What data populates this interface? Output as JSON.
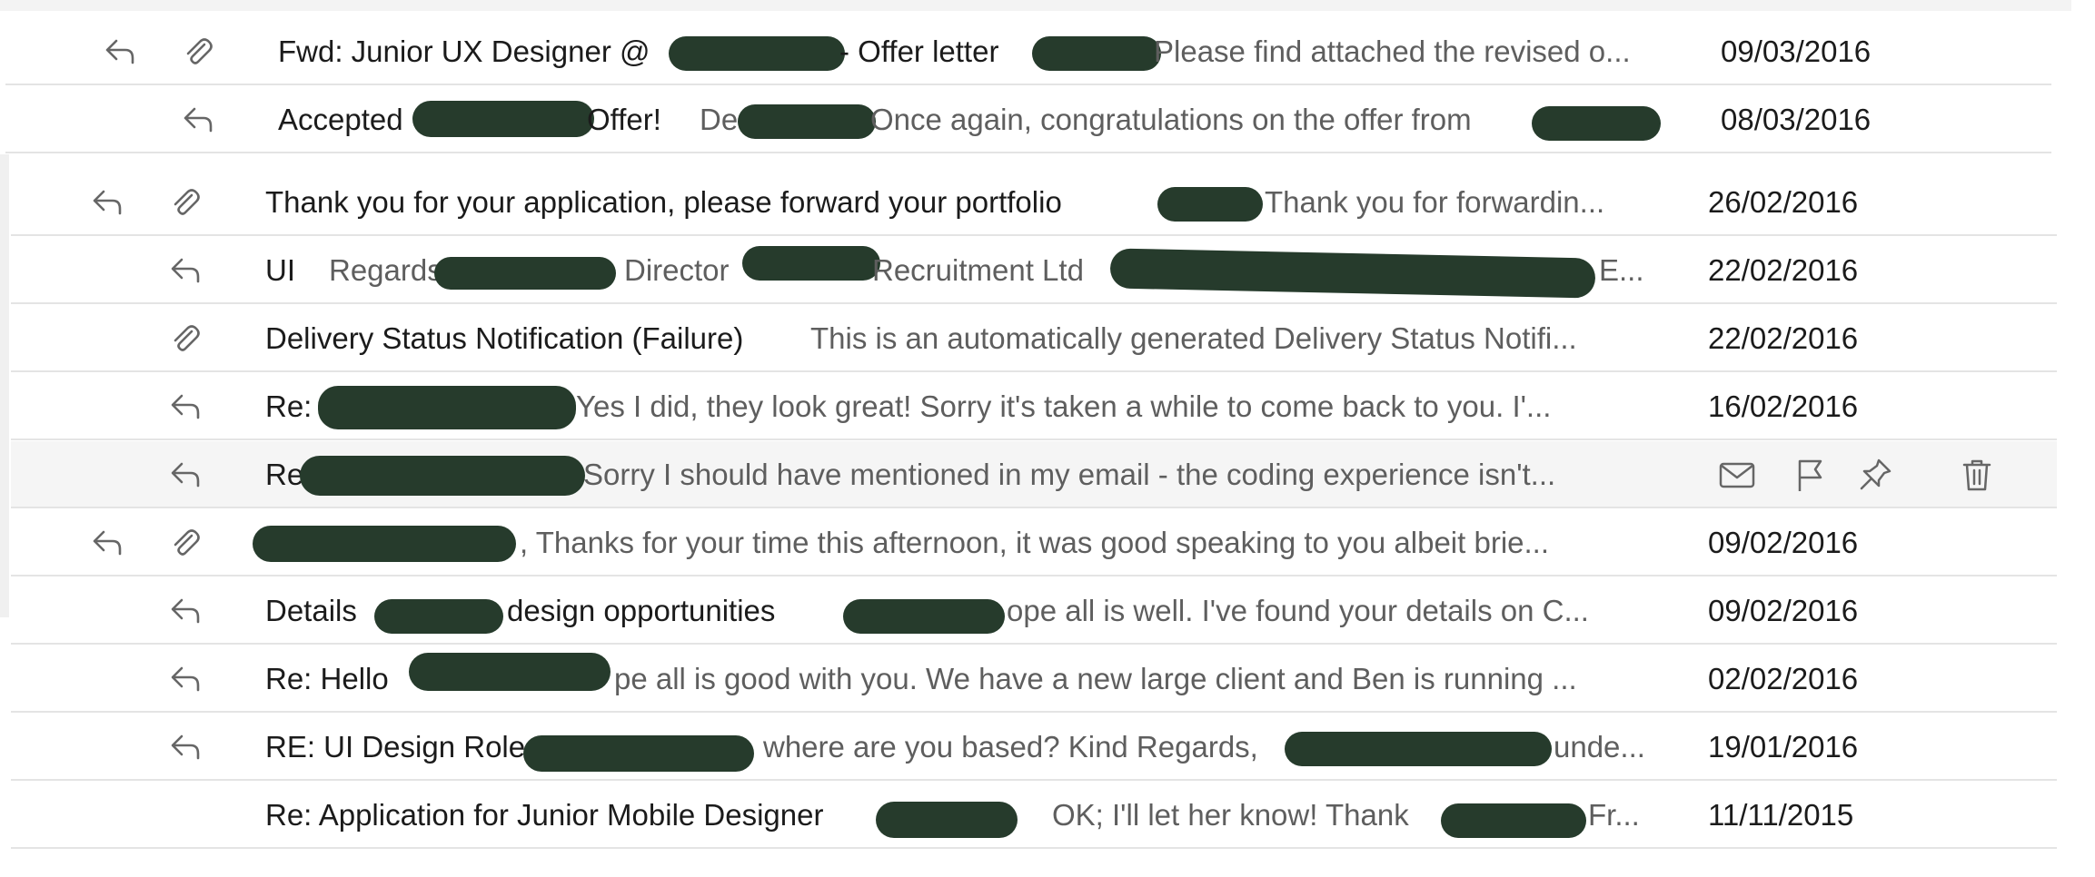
{
  "emails": [
    {
      "replied": true,
      "attachment": true,
      "subject": "Fwd: Junior UX Designer @",
      "subject2": "- Offer letter",
      "preview": "Please find attached the revised o...",
      "date": "09/03/2016"
    },
    {
      "replied": true,
      "attachment": false,
      "subject": "Accepted",
      "subject2": "Offer!",
      "preview": "De",
      "preview2": "Once again, congratulations on the offer from",
      "date": "08/03/2016"
    },
    {
      "replied": true,
      "attachment": true,
      "subject": "Thank you for your application, please forward your portfolio",
      "preview": "Thank you for forwardin...",
      "date": "26/02/2016"
    },
    {
      "replied": true,
      "attachment": false,
      "subject": "UI",
      "preview": "Regards",
      "preview2": "Director",
      "preview3": "Recruitment Ltd",
      "preview4": "E...",
      "date": "22/02/2016"
    },
    {
      "replied": false,
      "attachment": true,
      "subject": "Delivery Status Notification (Failure)",
      "preview": "This is an automatically generated Delivery Status Notifi...",
      "date": "22/02/2016"
    },
    {
      "replied": true,
      "attachment": false,
      "subject": "Re:",
      "preview": "Yes I did, they look great! Sorry it's taken a while to come back to you. I'...",
      "date": "16/02/2016"
    },
    {
      "replied": true,
      "attachment": false,
      "subject": "Re",
      "preview": "Sorry I should have mentioned in my email - the coding experience isn't...",
      "date": ""
    },
    {
      "replied": true,
      "attachment": true,
      "subject": "",
      "preview": ", Thanks for your time this afternoon, it was good speaking to you albeit brie...",
      "date": "09/02/2016"
    },
    {
      "replied": true,
      "attachment": false,
      "subject": "Details",
      "subject2": "design opportunities",
      "preview": "ope all is well. I've found your details on C...",
      "date": "09/02/2016"
    },
    {
      "replied": true,
      "attachment": false,
      "subject": "Re: Hello",
      "preview": "pe all is good with you. We have a new large client and Ben is running ...",
      "date": "02/02/2016"
    },
    {
      "replied": true,
      "attachment": false,
      "subject": "RE: UI Design Role",
      "preview": "where are you based? Kind Regards,",
      "preview2": "unde...",
      "date": "19/01/2016"
    },
    {
      "replied": false,
      "attachment": false,
      "subject": "Re: Application for Junior Mobile Designer",
      "preview": "OK; I'll let her know! Thank",
      "preview2": "Fr...",
      "date": "11/11/2015"
    }
  ],
  "hover_actions": [
    "envelope-icon",
    "flag-icon",
    "pin-icon",
    "trash-icon"
  ],
  "colors": {
    "redaction": "#263b2c",
    "hover_row": "#f5f5f5",
    "divider": "#e4e4e4",
    "preview_text": "#5e5e5e"
  }
}
